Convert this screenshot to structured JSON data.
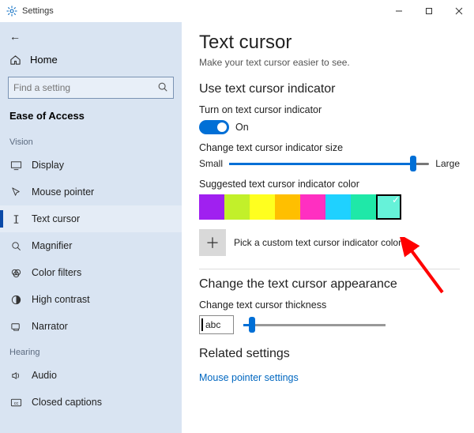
{
  "window": {
    "title": "Settings"
  },
  "sidebar": {
    "home": "Home",
    "search_placeholder": "Find a setting",
    "section": "Ease of Access",
    "groups": [
      {
        "name": "Vision",
        "items": [
          {
            "label": "Display"
          },
          {
            "label": "Mouse pointer"
          },
          {
            "label": "Text cursor",
            "selected": true
          },
          {
            "label": "Magnifier"
          },
          {
            "label": "Color filters"
          },
          {
            "label": "High contrast"
          },
          {
            "label": "Narrator"
          }
        ]
      },
      {
        "name": "Hearing",
        "items": [
          {
            "label": "Audio"
          },
          {
            "label": "Closed captions"
          }
        ]
      }
    ]
  },
  "main": {
    "title": "Text cursor",
    "subtitle": "Make your text cursor easier to see.",
    "section_indicator": "Use text cursor indicator",
    "toggle_label": "Turn on text cursor indicator",
    "toggle_state": "On",
    "size_label": "Change text cursor indicator size",
    "size_small": "Small",
    "size_large": "Large",
    "size_value_pct": 92,
    "color_label": "Suggested text cursor indicator color",
    "colors": [
      {
        "hex": "#a020f0"
      },
      {
        "hex": "#c2f02a"
      },
      {
        "hex": "#ffff1f"
      },
      {
        "hex": "#ffbf00"
      },
      {
        "hex": "#ff2fc1"
      },
      {
        "hex": "#1fd1ff"
      },
      {
        "hex": "#1fe8a8"
      },
      {
        "hex": "#66f2d9",
        "selected": true
      }
    ],
    "custom_color_label": "Pick a custom text cursor indicator color",
    "section_appearance": "Change the text cursor appearance",
    "thickness_label": "Change text cursor thickness",
    "thickness_value_pct": 6,
    "preview_text": "abc",
    "section_related": "Related settings",
    "related_link": "Mouse pointer settings"
  },
  "icons": {
    "search": "⌕",
    "home": "⌂",
    "plus": "＋"
  }
}
